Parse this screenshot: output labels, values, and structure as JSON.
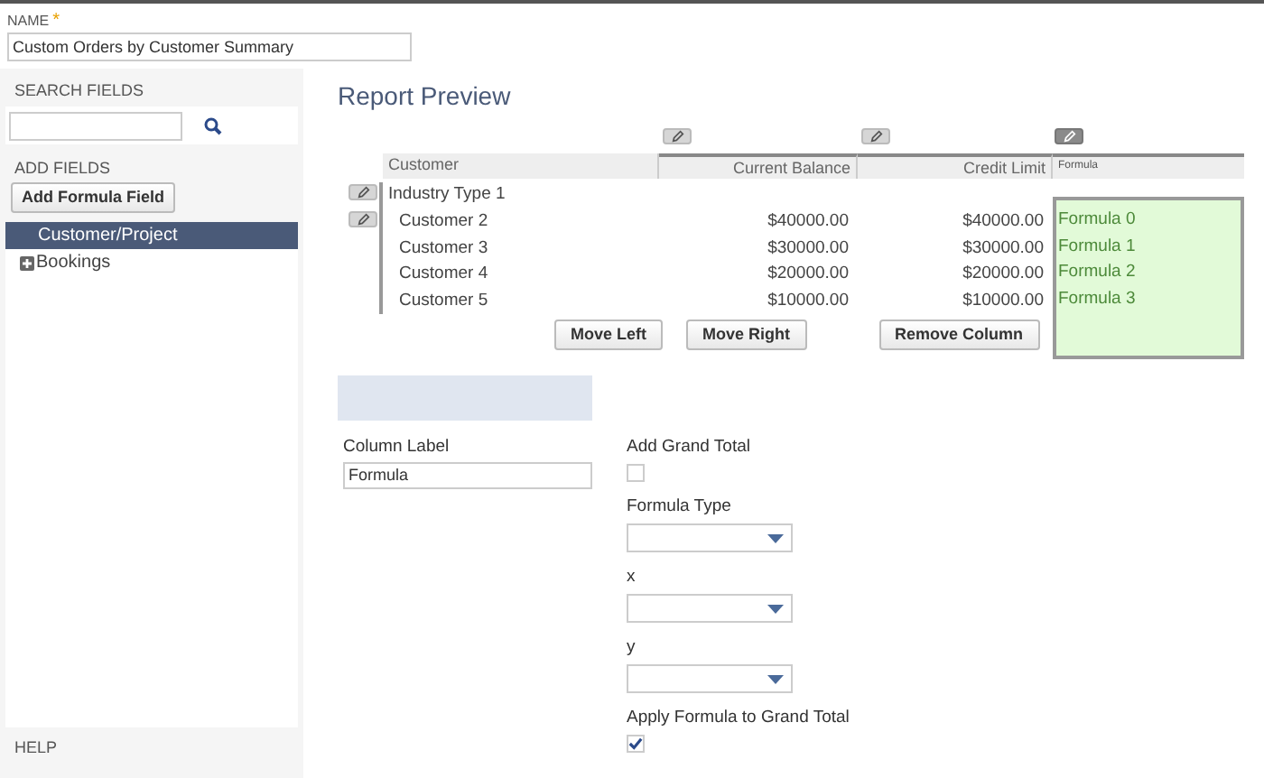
{
  "name_field": {
    "label": "NAME",
    "required_mark": "*",
    "value": "Custom Orders by Customer Summary"
  },
  "sidebar": {
    "search_label": "SEARCH FIELDS",
    "add_label": "ADD FIELDS",
    "add_button": "Add Formula Field",
    "items": [
      {
        "label": "Customer/Project",
        "selected": true,
        "expandable": false
      },
      {
        "label": "Bookings",
        "selected": false,
        "expandable": true
      }
    ],
    "help": "HELP"
  },
  "report": {
    "title": "Report Preview",
    "columns": [
      {
        "label": "Customer",
        "selected": false
      },
      {
        "label": "Current Balance",
        "selected": false
      },
      {
        "label": "Credit Limit",
        "selected": false
      },
      {
        "label": "Formula",
        "selected": true
      }
    ],
    "rows": [
      {
        "kind": "group",
        "cells": [
          "Industry Type 1"
        ]
      },
      {
        "kind": "row",
        "cells": [
          "Customer 2",
          "$40000.00",
          "$40000.00",
          "Formula 0"
        ]
      },
      {
        "kind": "row",
        "cells": [
          "Customer 3",
          "$30000.00",
          "$30000.00",
          "Formula 1"
        ]
      },
      {
        "kind": "row",
        "cells": [
          "Customer 4",
          "$20000.00",
          "$20000.00",
          "Formula 2"
        ]
      },
      {
        "kind": "row",
        "cells": [
          "Customer 5",
          "$10000.00",
          "$10000.00",
          "Formula 3"
        ]
      }
    ],
    "buttons": [
      "Move Left",
      "Move Right",
      "Remove Column"
    ]
  },
  "editor": {
    "column_label": {
      "label": "Column Label",
      "value": "Formula"
    },
    "add_grand_total": {
      "label": "Add Grand Total",
      "checked": false
    },
    "selects": [
      {
        "label": "Formula Type"
      },
      {
        "label": "x"
      },
      {
        "label": "y"
      }
    ],
    "apply_grand_total": {
      "label": "Apply Formula to Grand Total",
      "checked": true
    }
  }
}
